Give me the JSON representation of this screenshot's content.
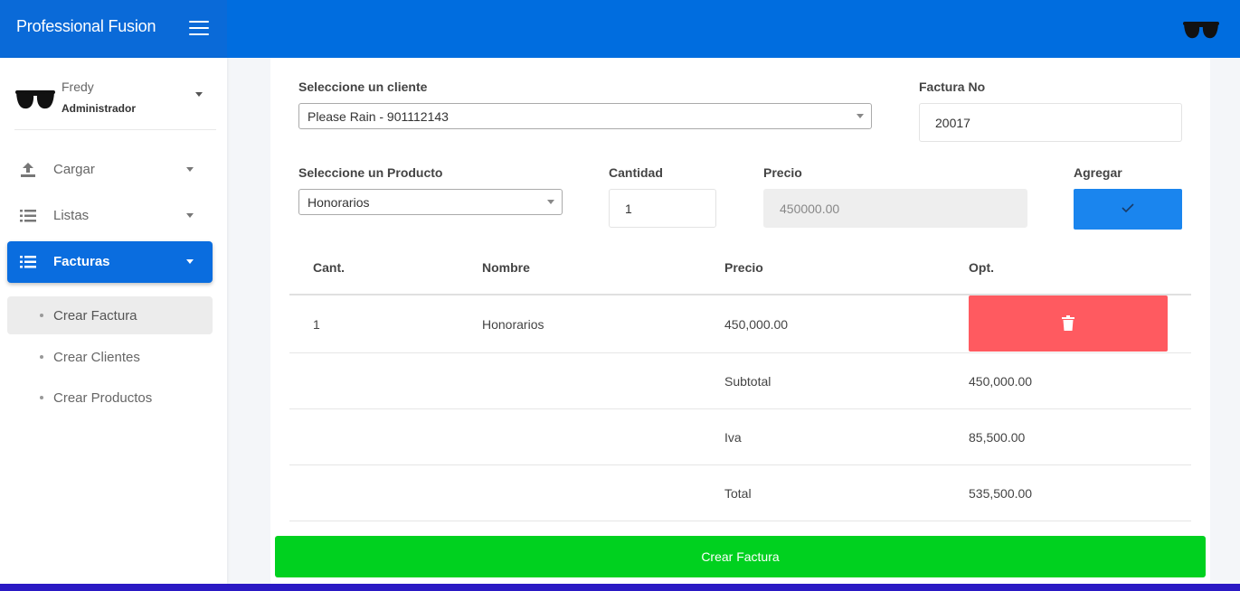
{
  "app": {
    "title": "Professional Fusion"
  },
  "user": {
    "name": "Fredy",
    "role": "Administrador"
  },
  "sidebar": {
    "items": [
      {
        "label": "Cargar",
        "icon": "upload-icon"
      },
      {
        "label": "Listas",
        "icon": "list-icon"
      },
      {
        "label": "Facturas",
        "icon": "list-icon",
        "active": true
      }
    ],
    "subitems": [
      {
        "label": "Crear Factura",
        "active": true
      },
      {
        "label": "Crear Clientes"
      },
      {
        "label": "Crear Productos"
      }
    ]
  },
  "form": {
    "client_label": "Seleccione un cliente",
    "client_value": "Please Rain - 901112143",
    "invoice_label": "Factura No",
    "invoice_value": "20017",
    "product_label": "Seleccione un Producto",
    "product_value": "Honorarios",
    "quantity_label": "Cantidad",
    "quantity_value": "1",
    "price_label": "Precio",
    "price_value": "450000.00",
    "add_label": "Agregar"
  },
  "table": {
    "headers": [
      "Cant.",
      "Nombre",
      "Precio",
      "Opt."
    ],
    "rows": [
      {
        "qty": "1",
        "name": "Honorarios",
        "price": "450,000.00"
      }
    ],
    "subtotal_label": "Subtotal",
    "subtotal_value": "450,000.00",
    "iva_label": "Iva",
    "iva_value": "85,500.00",
    "total_label": "Total",
    "total_value": "535,500.00"
  },
  "actions": {
    "create_label": "Crear Factura"
  },
  "colors": {
    "topbar": "#006ddf",
    "active_nav": "#0a6ddf",
    "add_button": "#1a85ee",
    "delete_button": "#ff5a60",
    "create_button": "#00d11f"
  }
}
